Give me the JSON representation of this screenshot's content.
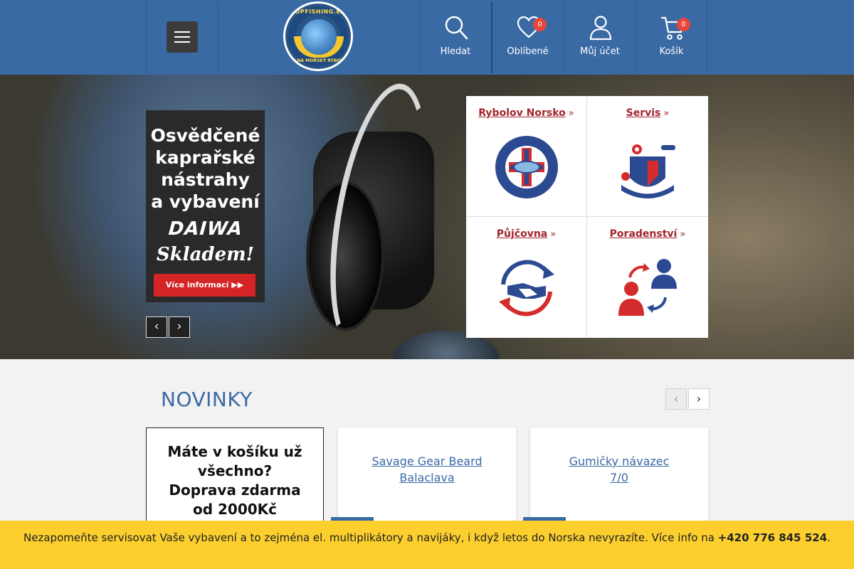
{
  "header": {
    "menu_label": "",
    "logo": {
      "top_text": "TOPFISHING.EU",
      "bottom_text": "VŠE NA MOŘSKÝ RYBOLOV"
    },
    "nav": [
      {
        "label": "Hledat",
        "icon": "search-icon"
      },
      {
        "label": "Oblíbené",
        "icon": "heart-icon",
        "badge": "0"
      },
      {
        "label": "Můj účet",
        "icon": "user-icon"
      },
      {
        "label": "Košík",
        "icon": "cart-icon",
        "badge": "0"
      }
    ],
    "colors": {
      "bar": "#3a6aa4",
      "badge": "#e8463b"
    }
  },
  "hero": {
    "promo": {
      "line1": "Osvědčené",
      "line2": "kaprařské",
      "line3": "nástrahy",
      "line4": "a vybavení",
      "brand": "DAIWA",
      "stock": "Skladem!",
      "button": "Více informací ▶▶"
    },
    "prev": "‹",
    "next": "›",
    "services": [
      {
        "title": "Rybolov Norsko",
        "icon": "norway-fishing-logo-icon"
      },
      {
        "title": "Servis",
        "icon": "service-tools-icon"
      },
      {
        "title": "Půjčovna",
        "icon": "rental-handshake-icon"
      },
      {
        "title": "Poradenství",
        "icon": "advice-people-icon"
      }
    ],
    "chevron": "»",
    "accent": "#a3242c"
  },
  "novinky": {
    "title": "NOVINKY",
    "prev": "‹",
    "next": "›",
    "promo_card": {
      "line1": "Máte v košíku už",
      "line2": "všechno?",
      "line3": "Doprava zdarma",
      "line4": "od 2000Kč"
    },
    "products": [
      {
        "name": "Savage Gear Beard Balaclava"
      },
      {
        "name": "Gumičky návazec 7/0"
      }
    ]
  },
  "notice": {
    "text": "Nezapomeňte servisovat Vaše vybavení a to zejména el. multiplikátory a navijáky, i když letos do Norska nevyrazíte. Více info na ",
    "phone": "+420 776 845 524",
    "end": ".",
    "color": "#fccf2e"
  }
}
